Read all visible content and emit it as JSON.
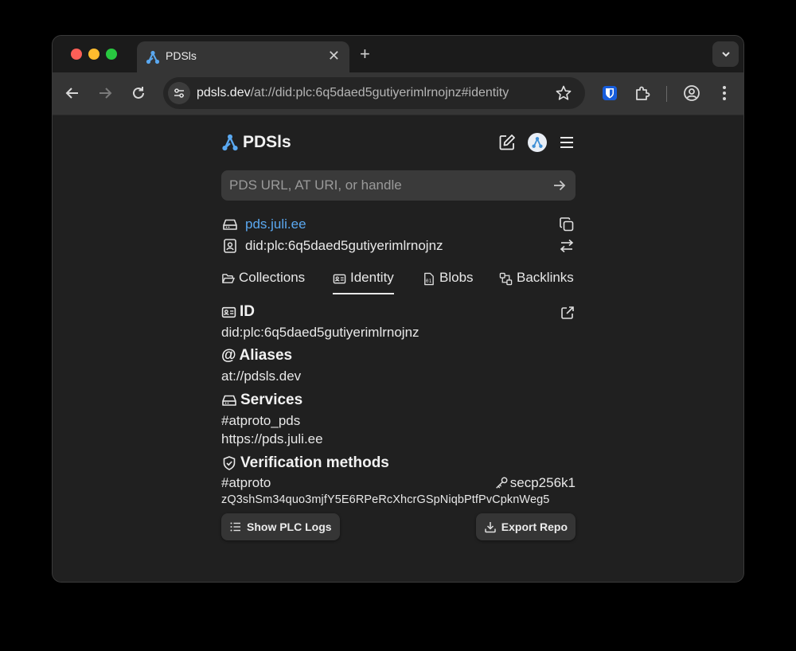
{
  "browser": {
    "tab_title": "PDSls",
    "url_host": "pdsls.dev",
    "url_path": "/at://did:plc:6q5daed5gutiyerimlrnojnz#identity"
  },
  "app": {
    "brand": "PDSls",
    "search_placeholder": "PDS URL, AT URI, or handle",
    "pds_host": "pds.juli.ee",
    "did": "did:plc:6q5daed5gutiyerimlrnojnz"
  },
  "tabs": [
    {
      "label": "Collections"
    },
    {
      "label": "Identity"
    },
    {
      "label": "Blobs"
    },
    {
      "label": "Backlinks"
    }
  ],
  "identity": {
    "id_title": "ID",
    "id_value": "did:plc:6q5daed5gutiyerimlrnojnz",
    "aliases_title": "Aliases",
    "alias_value": "at://pdsls.dev",
    "services_title": "Services",
    "service_id": "#atproto_pds",
    "service_endpoint": "https://pds.juli.ee",
    "verification_title": "Verification methods",
    "verification_id": "#atproto",
    "key_type": "secp256k1",
    "key_value": "zQ3shSm34quo3mjfY5E6RPeRcXhcrGSpNiqbPtfPvCpknWeg5"
  },
  "actions": {
    "plc_logs": "Show PLC Logs",
    "export_repo": "Export Repo"
  },
  "colors": {
    "accent_link": "#5aa8f0",
    "brand_icon": "#5aa8f0"
  }
}
